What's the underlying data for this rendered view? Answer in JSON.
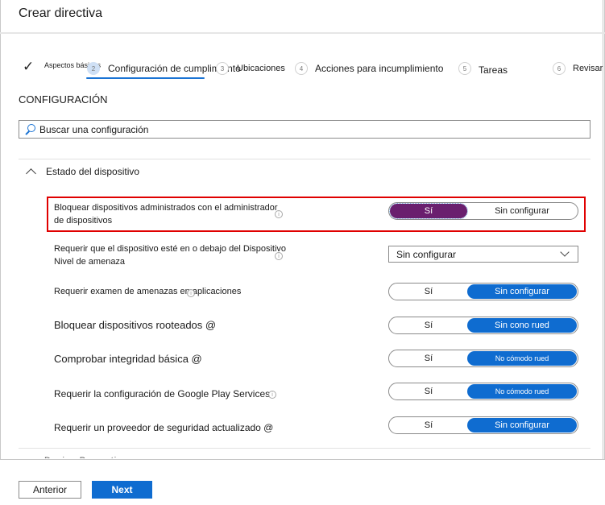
{
  "header": {
    "title": "Crear directiva"
  },
  "steps": [
    {
      "number": "1",
      "label": "Aspectos básicos",
      "state": "completed",
      "icon": "check-icon"
    },
    {
      "number": "2",
      "label": "Configuración de cumplimiento",
      "state": "active"
    },
    {
      "number": "3",
      "label": "Ubicaciones",
      "state": "pending"
    },
    {
      "number": "4",
      "label": "Acciones para incumplimiento",
      "state": "pending"
    },
    {
      "number": "5",
      "label": "Tareas",
      "state": "pending"
    },
    {
      "number": "6",
      "label": "Revisar",
      "state": "pending"
    }
  ],
  "section": {
    "title": "CONFIGURACIÓN"
  },
  "search": {
    "placeholder": "Buscar una configuración",
    "icon": "search-icon"
  },
  "group": {
    "label": "Estado del dispositivo",
    "expanded": true,
    "icon": "chevron-up-icon"
  },
  "settings": [
    {
      "label_line1": "Bloquear dispositivos administrados con el administrador",
      "label_line2": "de dispositivos",
      "control": "toggle",
      "yes": "Sí",
      "no": "Sin configurar",
      "selected": "yes",
      "highlighted": true
    },
    {
      "label_line1": "Requerir que el dispositivo esté en o debajo del Dispositivo",
      "label_line2": "Nivel de amenaza",
      "control": "dropdown",
      "value": "Sin configurar"
    },
    {
      "label": "Requerir examen de amenazas en aplicaciones",
      "control": "toggle",
      "yes": "Sí",
      "no": "Sin configurar",
      "selected": "no"
    },
    {
      "label": "Bloquear dispositivos rooteados @",
      "control": "toggle",
      "yes": "Sí",
      "no": "Sin cono rued",
      "selected": "no"
    },
    {
      "label": "Comprobar integridad básica @",
      "control": "toggle",
      "yes": "Sí",
      "no": "No cómodo rued",
      "selected": "no"
    },
    {
      "label": "Requerir la configuración de Google Play Services",
      "control": "toggle",
      "yes": "Sí",
      "no": "No cómodo rued",
      "selected": "no"
    },
    {
      "label": "Requerir un proveedor de seguridad actualizado @",
      "control": "toggle",
      "yes": "Sí",
      "no": "Sin configurar",
      "selected": "no"
    }
  ],
  "peek": {
    "text": "Device Properties"
  },
  "footer": {
    "prev_label": "Anterior",
    "next_label": "Next"
  },
  "colors": {
    "accent": "#0f6cd0",
    "selected_purple": "#6a1f6e",
    "highlight_border": "#e00000"
  }
}
